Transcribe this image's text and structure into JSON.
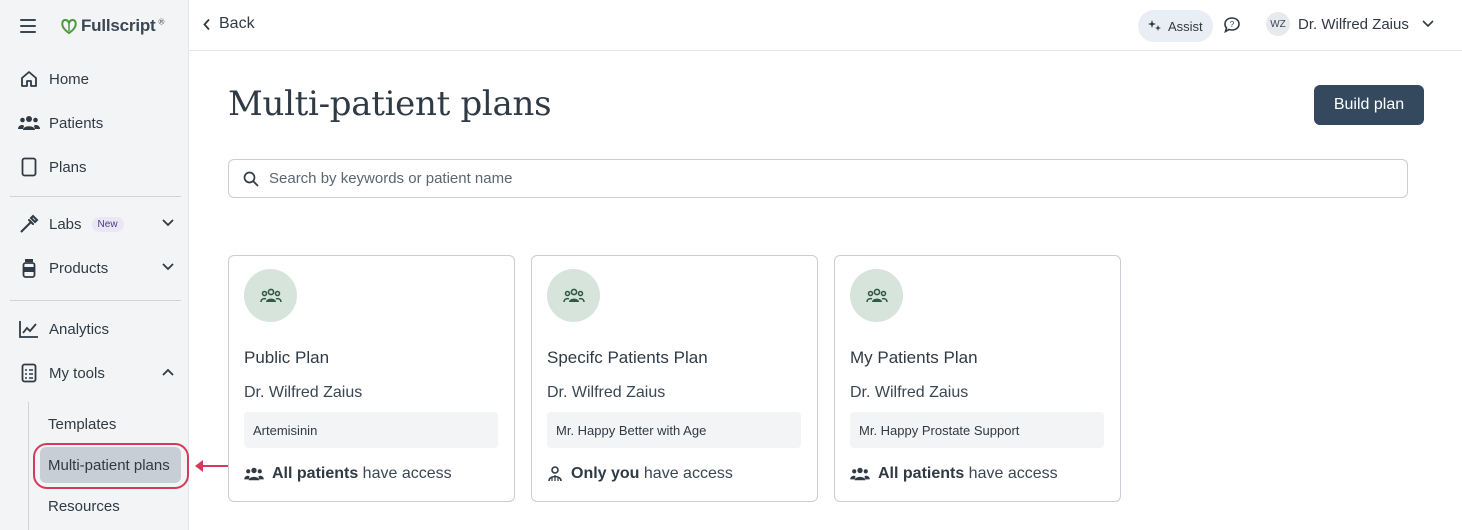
{
  "app": {
    "name": "Fullscript"
  },
  "sidebar": {
    "items": [
      {
        "label": "Home",
        "icon": "home-icon"
      },
      {
        "label": "Patients",
        "icon": "users-icon"
      },
      {
        "label": "Plans",
        "icon": "document-icon"
      },
      {
        "label": "Labs",
        "icon": "dropper-icon",
        "badge": "New"
      },
      {
        "label": "Products",
        "icon": "bottle-icon"
      },
      {
        "label": "Analytics",
        "icon": "chart-icon"
      },
      {
        "label": "My tools",
        "icon": "clipboard-icon"
      }
    ],
    "subitems": [
      {
        "label": "Templates"
      },
      {
        "label": "Multi-patient plans",
        "active": true
      },
      {
        "label": "Resources"
      }
    ]
  },
  "topbar": {
    "back_label": "Back",
    "assist_label": "Assist",
    "user": {
      "initials": "WZ",
      "name": "Dr. Wilfred Zaius"
    }
  },
  "main": {
    "title": "Multi-patient plans",
    "build_button": "Build plan",
    "search_placeholder": "Search by keywords or patient name",
    "cards": [
      {
        "title": "Public Plan",
        "author": "Dr. Wilfred Zaius",
        "product": "Artemisinin",
        "access_strong": "All patients",
        "access_rest": " have access"
      },
      {
        "title": "Specifc Patients Plan",
        "author": "Dr. Wilfred Zaius",
        "product": "Mr. Happy Better with Age",
        "access_strong": "Only you",
        "access_rest": " have access"
      },
      {
        "title": "My Patients Plan",
        "author": "Dr. Wilfred Zaius",
        "product": "Mr. Happy Prostate Support",
        "access_strong": "All patients",
        "access_rest": " have access"
      }
    ]
  },
  "colors": {
    "accent": "#34495e",
    "brand_green": "#4c9a3f",
    "highlight": "#d43a5c",
    "card_icon_bg": "#d6e4dc"
  }
}
